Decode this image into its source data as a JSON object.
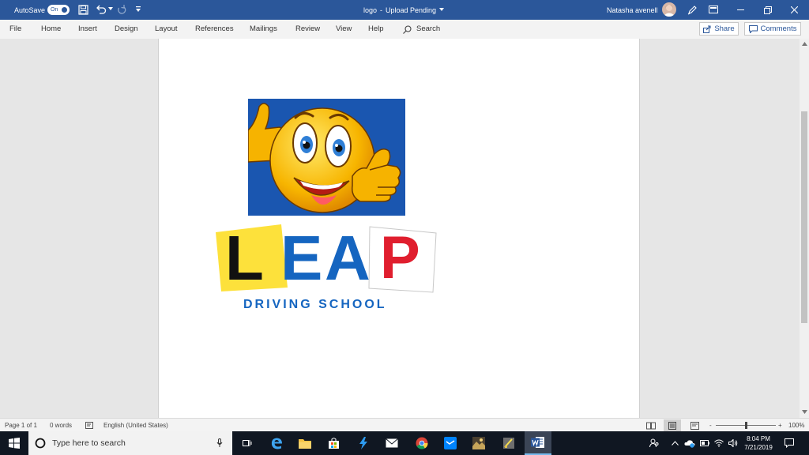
{
  "titlebar": {
    "autosave_label": "AutoSave",
    "autosave_state": "On",
    "document_title": "logo",
    "separator": "-",
    "upload_status": "Upload Pending",
    "user_name": "Natasha avenell"
  },
  "ribbon": {
    "tabs": [
      "File",
      "Home",
      "Insert",
      "Design",
      "Layout",
      "References",
      "Mailings",
      "Review",
      "View",
      "Help"
    ],
    "search_label": "Search",
    "share_label": "Share",
    "comments_label": "Comments"
  },
  "logo": {
    "letters": [
      "L",
      "E",
      "A",
      "P"
    ],
    "subtitle": "DRIVING SCHOOL"
  },
  "statusbar": {
    "page_info": "Page 1 of 1",
    "word_count": "0 words",
    "language": "English (United States)",
    "zoom_minus": "-",
    "zoom_plus": "+",
    "zoom_level": "100%",
    "zoom_fraction": 0.5
  },
  "taskbar": {
    "search_placeholder": "Type here to search",
    "time": "8:04 PM",
    "date": "7/21/2019"
  },
  "colors": {
    "word_blue": "#2b579a",
    "logo_blue": "#1565c0",
    "l_plate_yellow": "#fde13b",
    "p_red": "#e01e2e",
    "taskbar": "#101722"
  }
}
